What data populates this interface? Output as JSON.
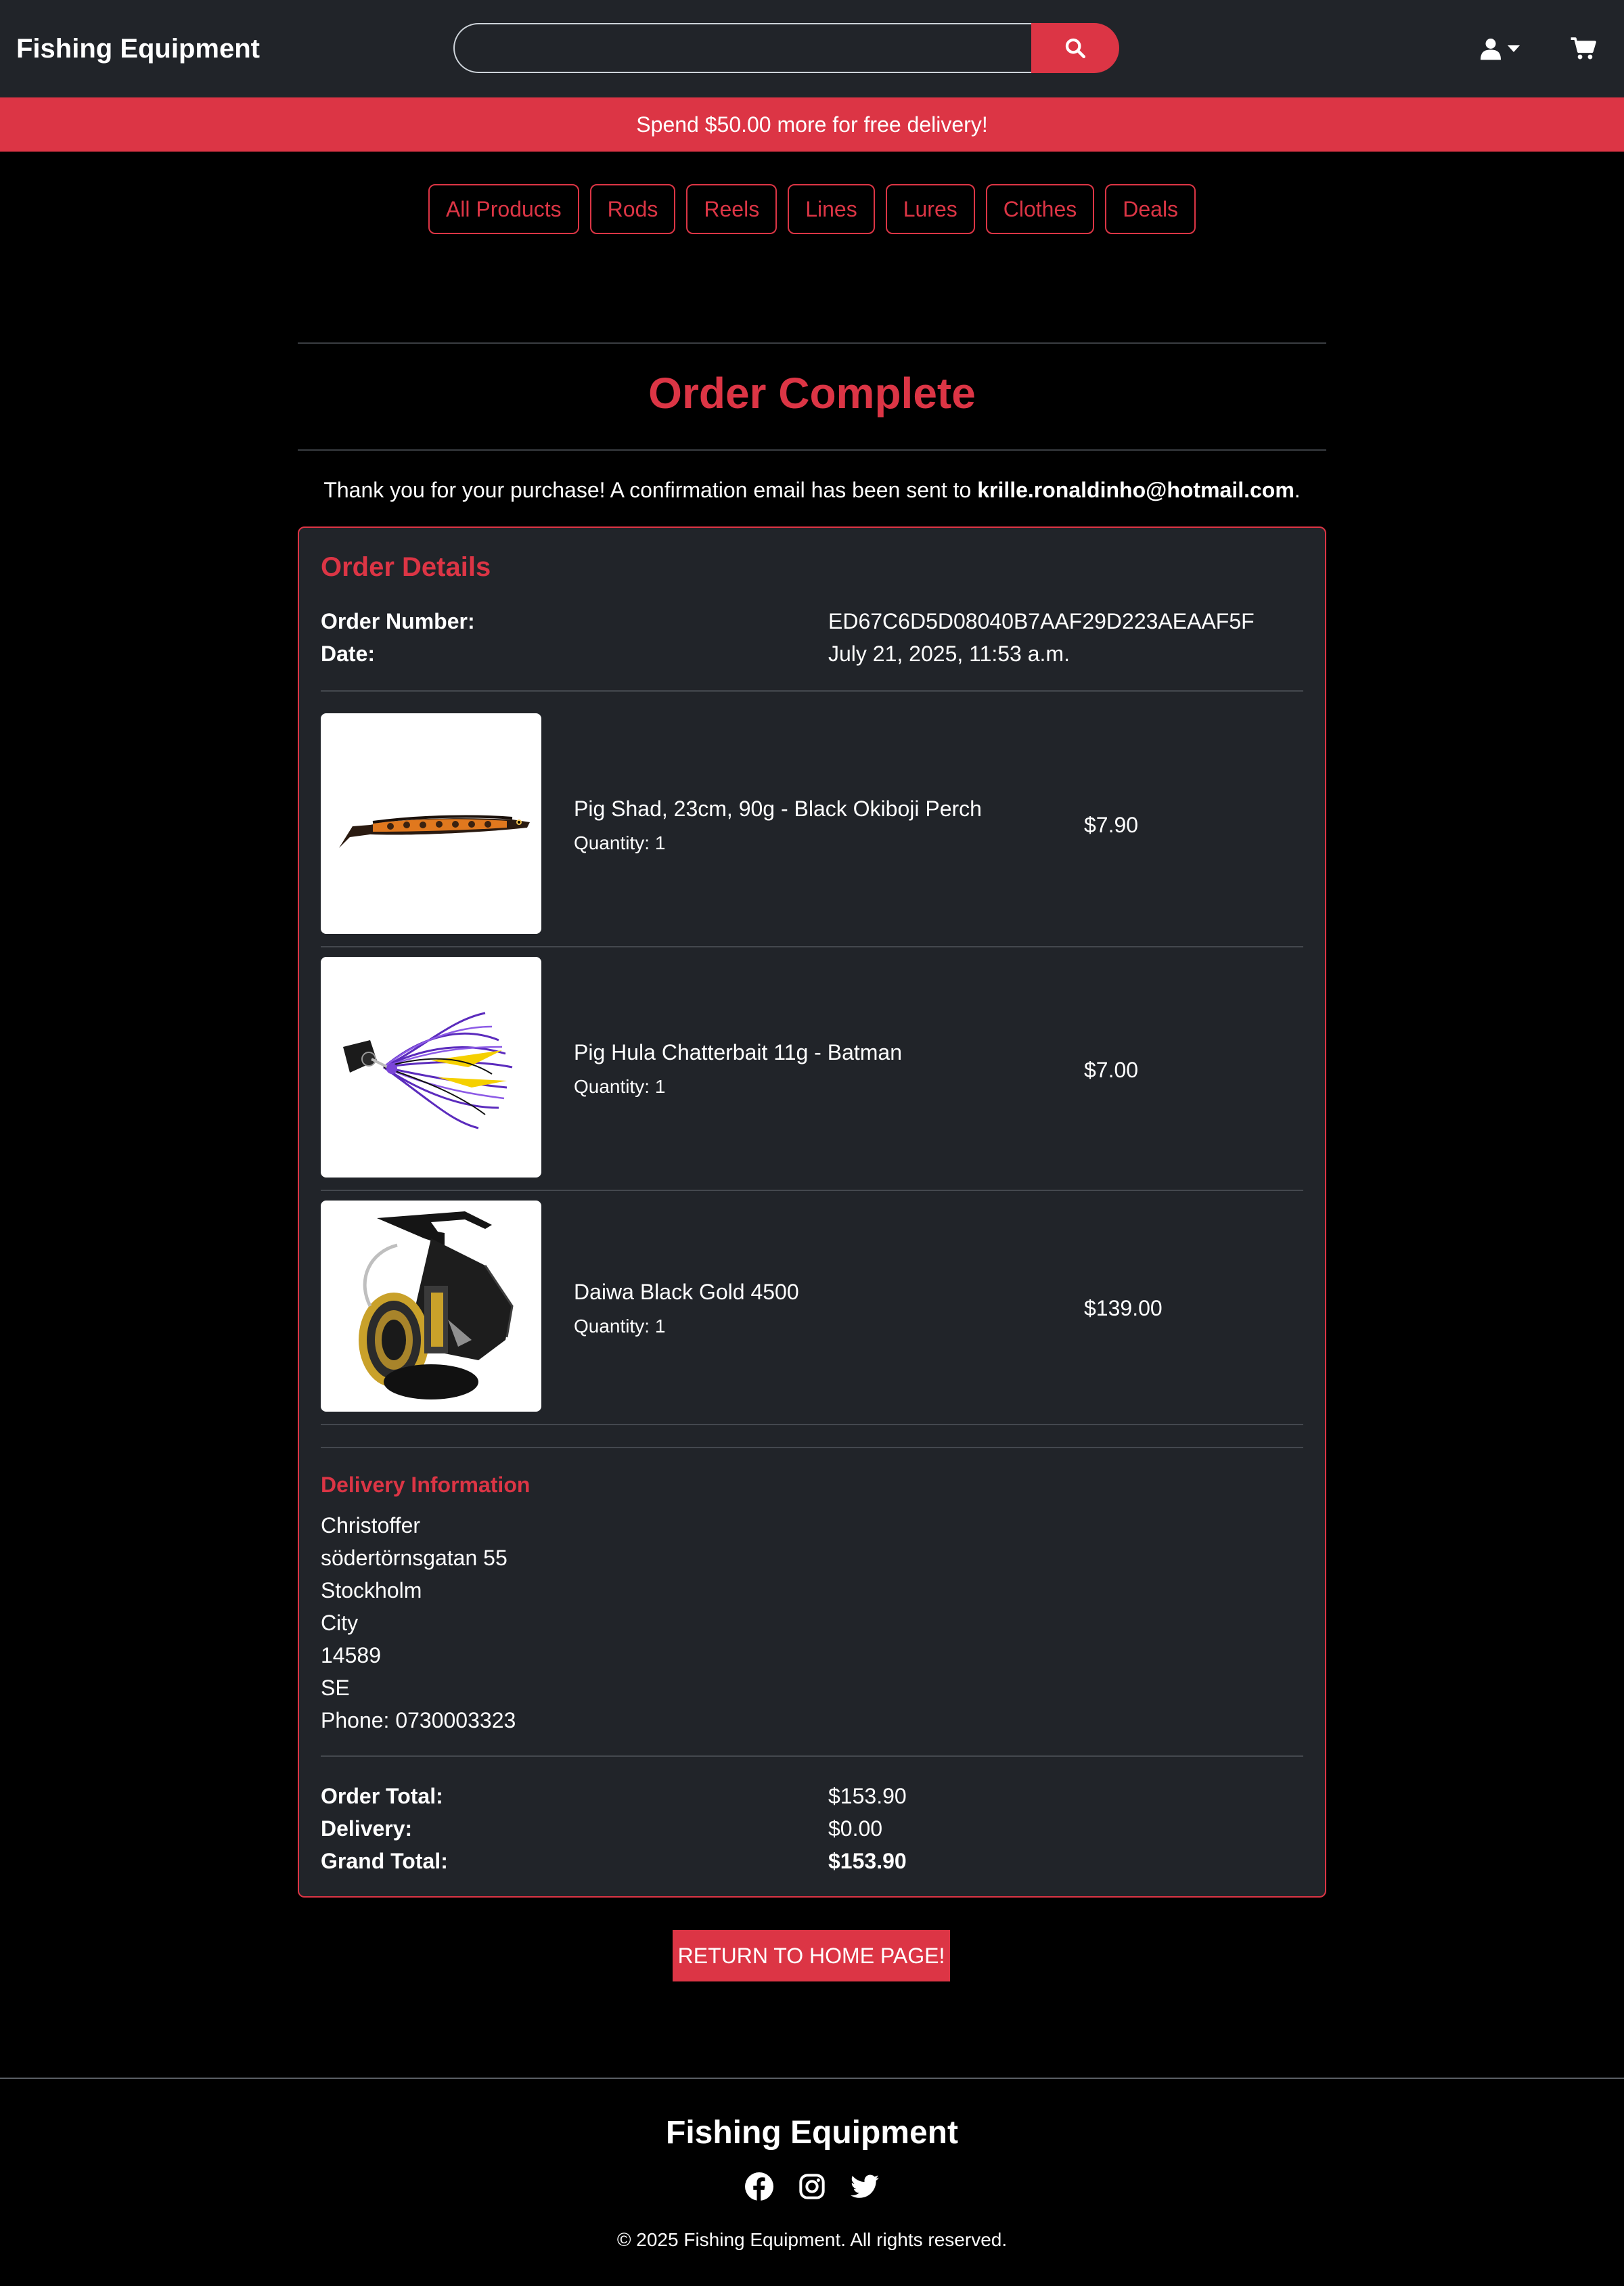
{
  "header": {
    "brand": "Fishing Equipment",
    "search_placeholder": "",
    "search_value": ""
  },
  "promo": {
    "text": "Spend $50.00 more for free delivery!"
  },
  "categories": [
    "All Products",
    "Rods",
    "Reels",
    "Lines",
    "Lures",
    "Clothes",
    "Deals"
  ],
  "page": {
    "title": "Order Complete",
    "thanks_prefix": "Thank you for your purchase! A confirmation email has been sent to ",
    "email": "krille.ronaldinho@hotmail.com",
    "thanks_suffix": "."
  },
  "order": {
    "heading": "Order Details",
    "number_label": "Order Number:",
    "number": "ED67C6D5D08040B7AAF29D223AEAAF5F",
    "date_label": "Date:",
    "date": "July 21, 2025, 11:53 a.m.",
    "items": [
      {
        "name": "Pig Shad, 23cm, 90g - Black Okiboji Perch",
        "quantity": "Quantity: 1",
        "price": "$7.90"
      },
      {
        "name": "Pig Hula Chatterbait 11g - Batman",
        "quantity": "Quantity: 1",
        "price": "$7.00"
      },
      {
        "name": "Daiwa Black Gold 4500",
        "quantity": "Quantity: 1",
        "price": "$139.00"
      }
    ],
    "delivery": {
      "heading": "Delivery Information",
      "name": "Christoffer",
      "street": "södertörnsgatan 55",
      "town": "Stockholm",
      "county": "City",
      "postcode": "14589",
      "country": "SE",
      "phone": "Phone: 0730003323"
    },
    "totals": {
      "order_total_label": "Order Total:",
      "order_total": "$153.90",
      "delivery_label": "Delivery:",
      "delivery": "$0.00",
      "grand_total_label": "Grand Total:",
      "grand_total": "$153.90"
    }
  },
  "actions": {
    "return_home": "RETURN TO HOME PAGE!"
  },
  "footer": {
    "brand": "Fishing Equipment",
    "copyright": "© 2025 Fishing Equipment. All rights reserved."
  },
  "colors": {
    "accent": "#dc3545",
    "navbar": "#212429",
    "background": "#000000"
  },
  "icons": [
    "search-icon",
    "user-icon",
    "caret-down-icon",
    "cart-icon",
    "facebook-icon",
    "instagram-icon",
    "twitter-icon"
  ]
}
